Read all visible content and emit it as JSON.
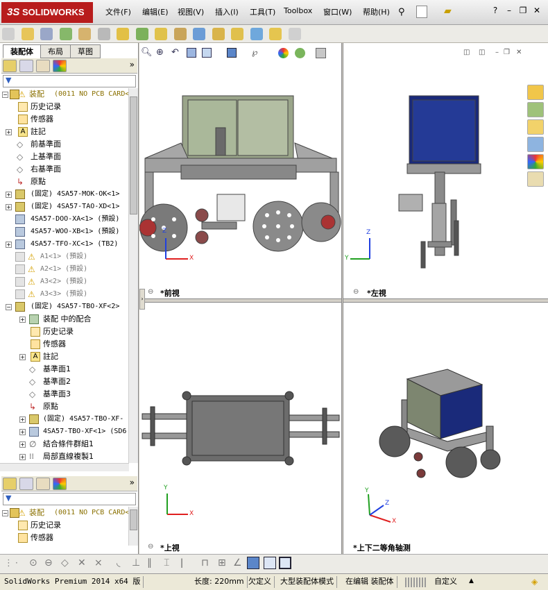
{
  "app": {
    "brand_prefix": "3S",
    "brand_name": "SOLIDWORKS"
  },
  "menu": [
    {
      "label": "文件(F)"
    },
    {
      "label": "编辑(E)"
    },
    {
      "label": "视图(V)"
    },
    {
      "label": "插入(I)"
    },
    {
      "label": "工具(T)"
    },
    {
      "label": "Toolbox"
    },
    {
      "label": "窗口(W)"
    },
    {
      "label": "帮助(H)"
    }
  ],
  "left_panel": {
    "tabs": [
      {
        "label": "装配体"
      },
      {
        "label": "布局"
      },
      {
        "label": "草图"
      }
    ],
    "tree_top": [
      {
        "label": "装配",
        "suffix": "(0011 NO PCB CARD<"
      },
      {
        "label": "历史记录"
      },
      {
        "label": "传感器"
      },
      {
        "label": "註記"
      },
      {
        "label": "前基準面"
      },
      {
        "label": "上基準面"
      },
      {
        "label": "右基準面"
      },
      {
        "label": "原點"
      },
      {
        "label": "(固定) 4SA57-MOK-OK<1>"
      },
      {
        "label": "(固定) 4SA57-TAO-XD<1>"
      },
      {
        "label": "4SA57-DOO-XA<1> (預設)"
      },
      {
        "label": "4SA57-WOO-XB<1> (預設)"
      },
      {
        "label": "4SA57-TFO-XC<1> (TB2)"
      },
      {
        "label": "A1<1> (預設)"
      },
      {
        "label": "A2<1> (預設)"
      },
      {
        "label": "A3<2> (預設)"
      },
      {
        "label": "A3<3> (預設)"
      },
      {
        "label": "(固定) 4SA57-TBO-XF<2>"
      },
      {
        "label": "装配 中的配合"
      },
      {
        "label": "历史记录"
      },
      {
        "label": "传感器"
      },
      {
        "label": "註記"
      },
      {
        "label": "基準面1"
      },
      {
        "label": "基準面2"
      },
      {
        "label": "基準面3"
      },
      {
        "label": "原點"
      },
      {
        "label": "(固定) 4SA57-TBO-XF-"
      },
      {
        "label": "4SA57-TBO-XF<1> (SD6"
      },
      {
        "label": "結合條件群組1"
      },
      {
        "label": "局部直線複製1"
      }
    ],
    "tree_bottom": [
      {
        "label": "装配",
        "suffix": "(0011 NO PCB CARD<"
      },
      {
        "label": "历史记录"
      },
      {
        "label": "传感器"
      }
    ]
  },
  "views": [
    {
      "label": "*前視"
    },
    {
      "label": "*左視"
    },
    {
      "label": "*上視"
    },
    {
      "label": "*上下二等角轴测"
    }
  ],
  "axes": {
    "x": "X",
    "y": "Y",
    "z": "Z"
  },
  "statusbar": {
    "product": "SolidWorks Premium 2014 x64 版",
    "length": "长度: 220mm",
    "state": "欠定义",
    "mode": "大型装配体模式",
    "editing": "在编辑 装配体",
    "custom": "自定义"
  },
  "colors": {
    "brand_red": "#b81c1c",
    "axis_x": "#e02020",
    "axis_y": "#20a020",
    "axis_z": "#2040e0",
    "frame_gray": "#9a9a9a",
    "box_green": "#9aa58a",
    "box_blue": "#1a2a7a"
  }
}
